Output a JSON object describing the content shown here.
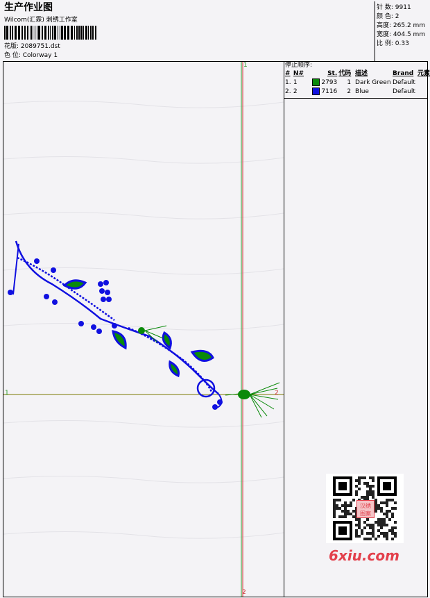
{
  "header": {
    "title": "生产作业图",
    "company": "Wilcom(汇霖) 刺绣工作室",
    "design_label": "花版: 2089751.dst",
    "colorway_label": "色 位: Colorway 1"
  },
  "stats": [
    {
      "label": "针 数",
      "value": "9911"
    },
    {
      "label": "颜 色",
      "value": "2"
    },
    {
      "label": "高度",
      "value": "265.2 mm"
    },
    {
      "label": "宽度",
      "value": "404.5 mm"
    },
    {
      "label": "比 例",
      "value": "0.33"
    }
  ],
  "stop_sequence": {
    "title": "停止顺序:",
    "headers": [
      "#",
      "N#",
      "St.",
      "代码",
      "描述",
      "Brand",
      "元素"
    ],
    "rows": [
      {
        "num": "1.",
        "needle": "1",
        "stitches": "2793",
        "code": "1",
        "description": "Dark Green",
        "brand": "Default",
        "color": "#0a8a0a"
      },
      {
        "num": "2.",
        "needle": "2",
        "stitches": "7116",
        "code": "2",
        "description": "Blue",
        "brand": "Default",
        "color": "#1010e0"
      }
    ]
  },
  "axis_markers": {
    "h_left": "1",
    "h_right": "2",
    "v_top": "1",
    "v_bottom": "2"
  },
  "watermark": {
    "badge": "汉绣\n图案",
    "site": "6xiu.com"
  },
  "colors": {
    "green": "#0a8a0a",
    "blue": "#1010e0",
    "axis": "#7a7a00"
  }
}
